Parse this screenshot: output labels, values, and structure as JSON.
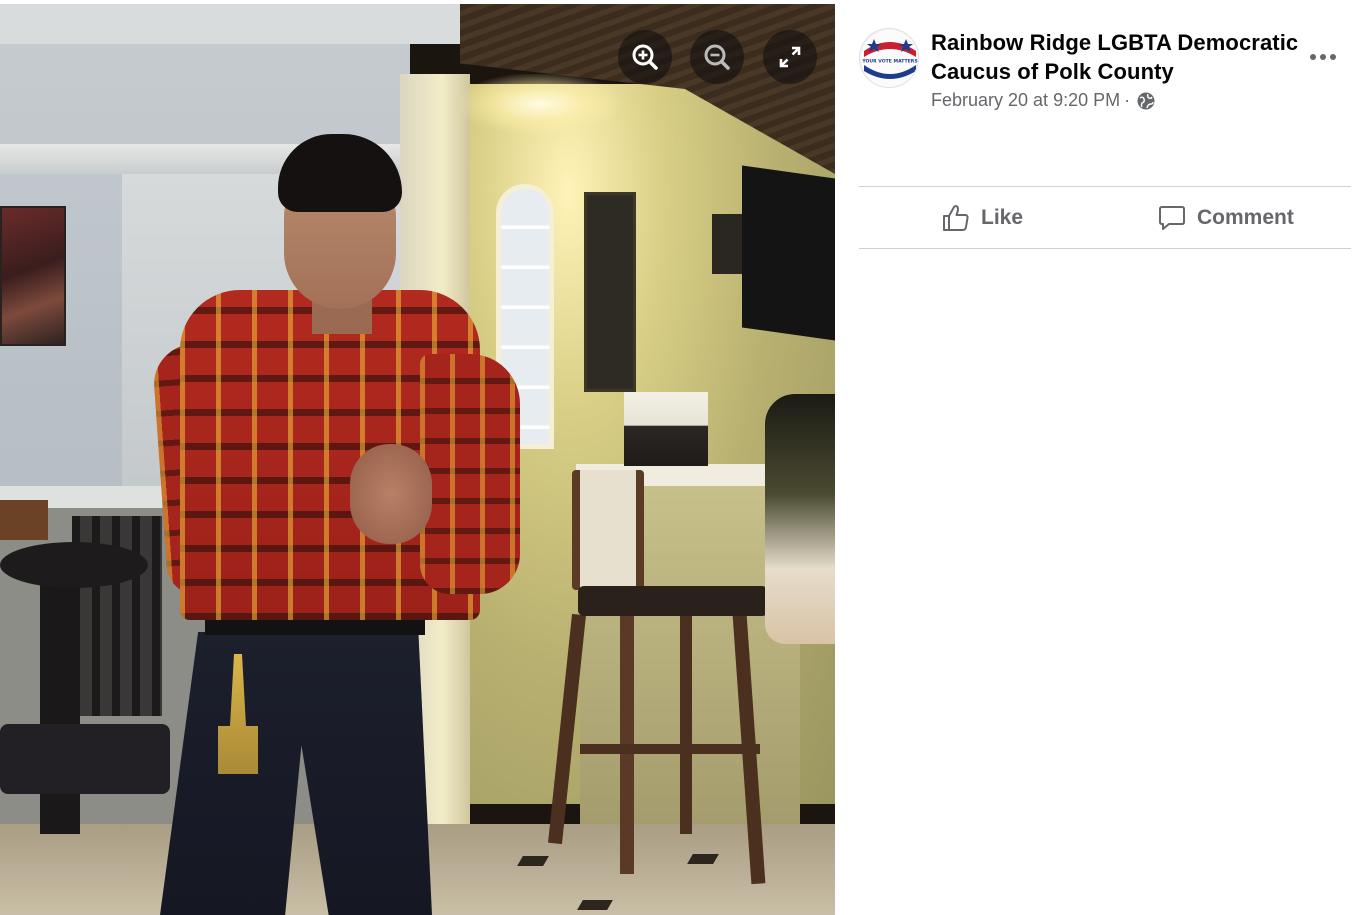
{
  "viewer": {
    "controls": {
      "zoom_in_icon": "zoom-in-icon",
      "zoom_out_icon": "zoom-out-icon",
      "fullscreen_icon": "fullscreen-expand-icon"
    }
  },
  "post": {
    "author": "Rainbow Ridge LGBTA Democratic Caucus of Polk County",
    "timestamp": "February 20 at 9:20 PM",
    "separator": "·",
    "audience_icon": "globe-icon",
    "more_icon": "more-horizontal-icon",
    "avatar_badge_text": "YOUR VOTE MATTERS"
  },
  "actions": {
    "like_label": "Like",
    "comment_label": "Comment"
  },
  "colors": {
    "text_primary": "#050505",
    "text_secondary": "#65676b",
    "divider": "#ced0d4"
  }
}
